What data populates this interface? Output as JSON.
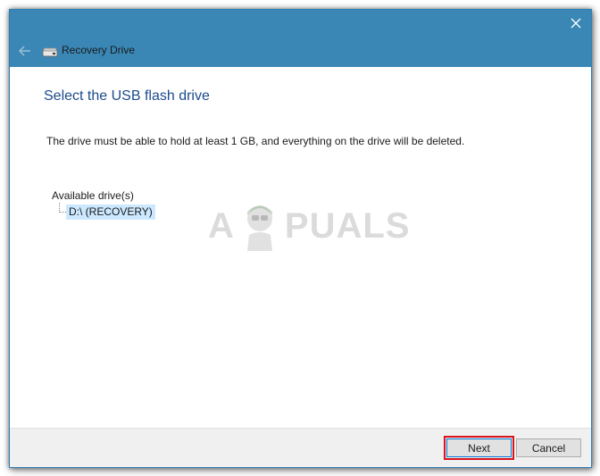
{
  "window": {
    "title": "Recovery Drive",
    "close_glyph": "✕",
    "back_glyph": "←",
    "icons": [
      "back-arrow-icon",
      "drive-icon",
      "close-icon"
    ],
    "titlebar_color": "#3a87b6"
  },
  "main": {
    "heading": "Select the USB flash drive",
    "description": "The drive must be able to hold at least 1 GB, and everything on the drive will be deleted.",
    "drives_label": "Available drive(s)",
    "drives": [
      {
        "label": "D:\\ (RECOVERY)",
        "selected": true
      }
    ],
    "selection_color": "#cce8ff"
  },
  "watermark": {
    "left_text": "A",
    "right_text": "PUALS"
  },
  "footer": {
    "next_label": "Next",
    "cancel_label": "Cancel",
    "highlight_color": "#d9141d"
  }
}
